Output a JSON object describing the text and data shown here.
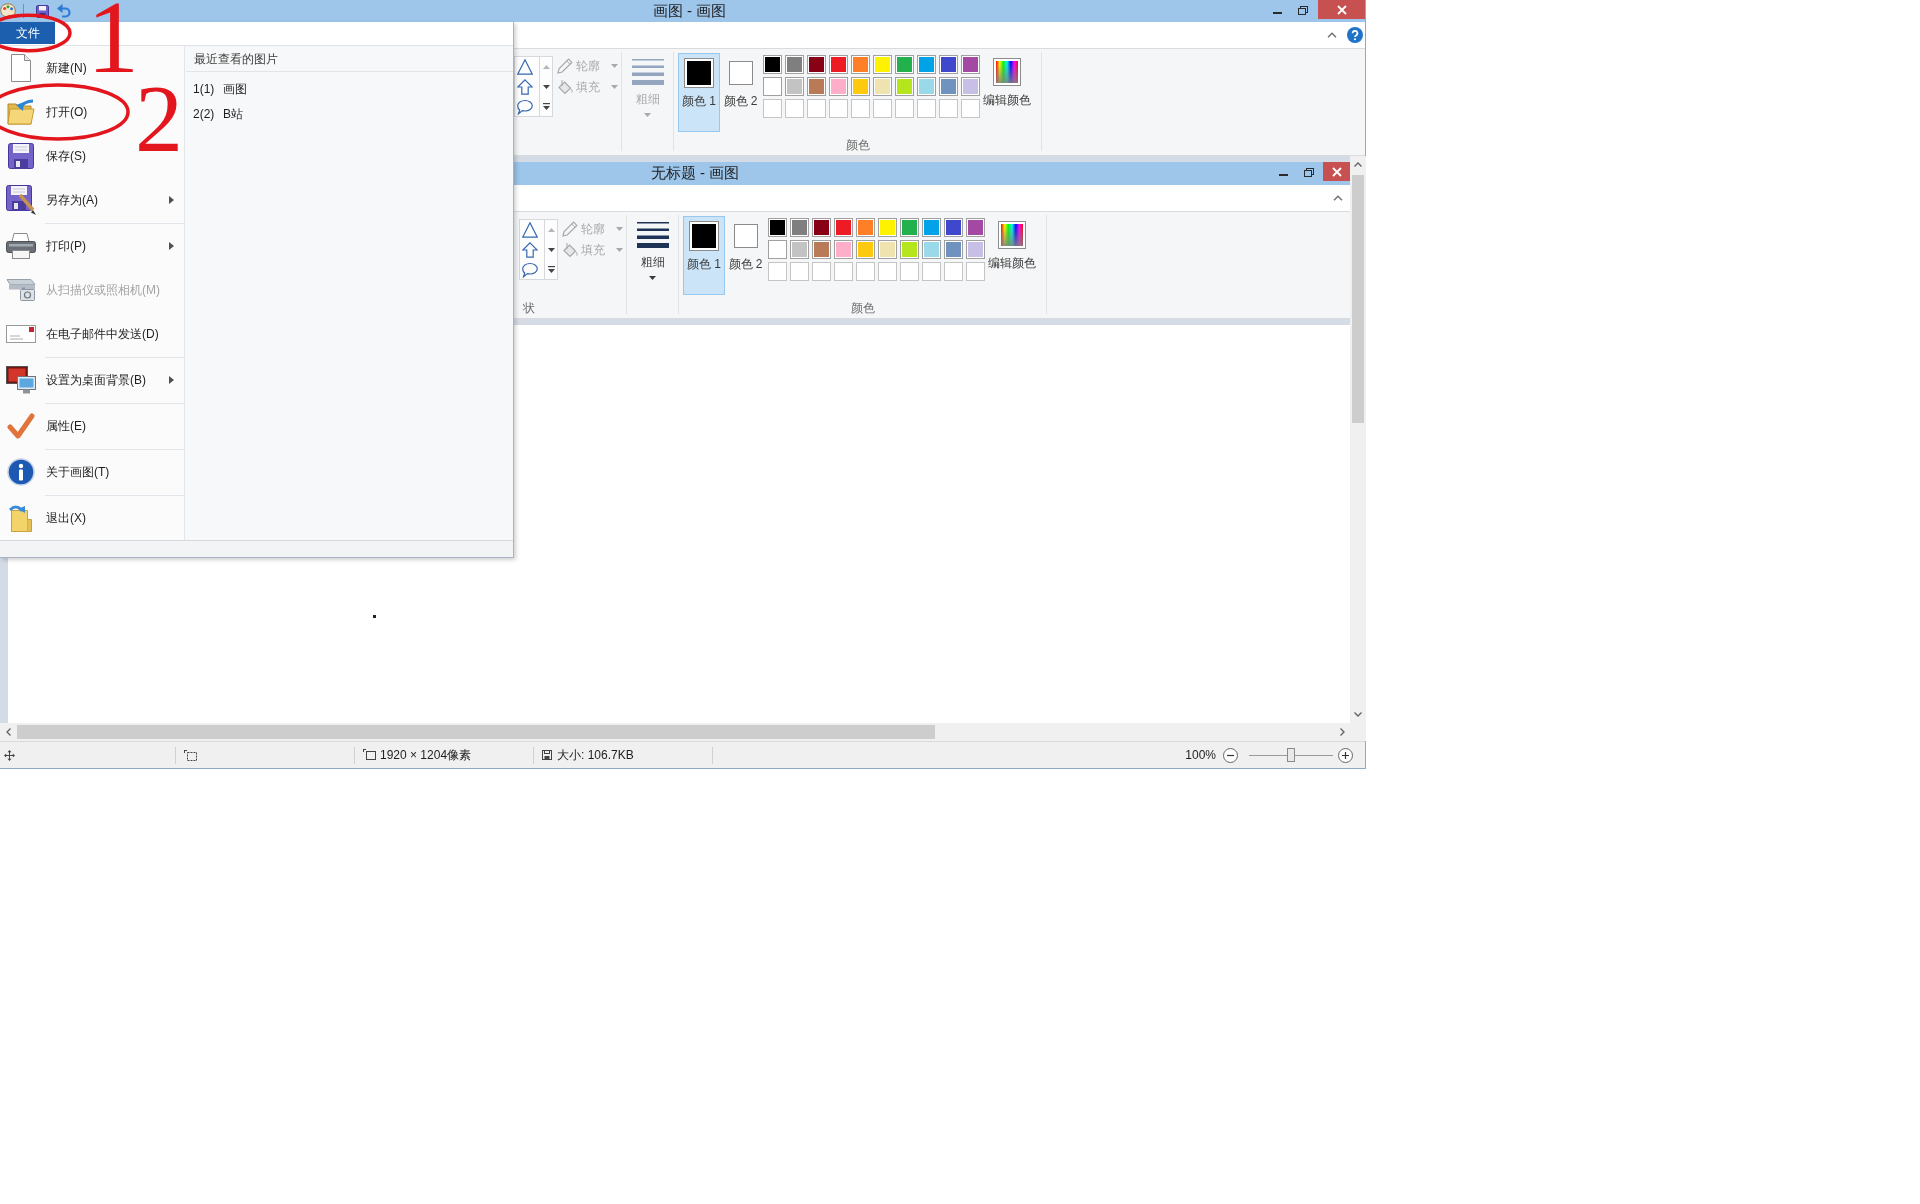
{
  "window": {
    "title": "画图 - 画图",
    "ribbon": {
      "outline": {
        "label": "轮廓",
        "disabled": true
      },
      "fill": {
        "label": "填充",
        "disabled": true
      },
      "size": {
        "label": "粗细",
        "disabled": true
      },
      "color1": {
        "label": "颜色 1",
        "color": "#000000",
        "selected": true
      },
      "color2": {
        "label": "颜色 2",
        "color": "#ffffff",
        "selected": false
      },
      "palette": [
        {
          "kind": "swatch",
          "color": "#000000"
        },
        {
          "kind": "swatch",
          "color": "#7f7f7f"
        },
        {
          "kind": "swatch",
          "color": "#880015"
        },
        {
          "kind": "swatch",
          "color": "#ed1c24"
        },
        {
          "kind": "swatch",
          "color": "#ff7f27"
        },
        {
          "kind": "swatch",
          "color": "#fff200"
        },
        {
          "kind": "swatch",
          "color": "#22b14c"
        },
        {
          "kind": "swatch",
          "color": "#00a2e8"
        },
        {
          "kind": "swatch",
          "color": "#3f48cc"
        },
        {
          "kind": "swatch",
          "color": "#a349a4"
        },
        {
          "kind": "swatch",
          "color": "#ffffff"
        },
        {
          "kind": "swatch",
          "color": "#c3c3c3"
        },
        {
          "kind": "swatch",
          "color": "#b97a57"
        },
        {
          "kind": "swatch",
          "color": "#ffaec9"
        },
        {
          "kind": "swatch",
          "color": "#ffc90e"
        },
        {
          "kind": "swatch",
          "color": "#efe4b0"
        },
        {
          "kind": "swatch",
          "color": "#b5e61d"
        },
        {
          "kind": "swatch",
          "color": "#99d9ea"
        },
        {
          "kind": "swatch",
          "color": "#7092be"
        },
        {
          "kind": "swatch",
          "color": "#c8bfe7"
        },
        {
          "kind": "blank"
        },
        {
          "kind": "blank"
        },
        {
          "kind": "blank"
        },
        {
          "kind": "blank"
        },
        {
          "kind": "blank"
        },
        {
          "kind": "blank"
        },
        {
          "kind": "blank"
        },
        {
          "kind": "blank"
        },
        {
          "kind": "blank"
        },
        {
          "kind": "blank"
        }
      ],
      "edit_colors": {
        "label": "编辑颜色"
      },
      "colors_group": "颜色"
    },
    "status_bar": {
      "canvas_size": "1920 × 1204像素",
      "file_size": "大小: 106.7KB",
      "zoom": "100%",
      "zoom_slider": {
        "level": 0.5
      }
    }
  },
  "file_menu": {
    "tab": {
      "label": "文件",
      "selected": true
    },
    "command_groups": [
      {
        "commands": [
          {
            "label": "新建(N)",
            "submenu": false,
            "disabled": false
          },
          {
            "label": "打开(O)",
            "submenu": false,
            "disabled": false
          },
          {
            "label": "保存(S)",
            "submenu": false,
            "disabled": false
          },
          {
            "label": "另存为(A)",
            "submenu": true,
            "disabled": false
          }
        ]
      },
      {
        "commands": [
          {
            "label": "打印(P)",
            "submenu": true,
            "disabled": false
          },
          {
            "label": "从扫描仪或照相机(M)",
            "submenu": false,
            "disabled": true
          },
          {
            "label": "在电子邮件中发送(D)",
            "submenu": false,
            "disabled": false
          }
        ]
      },
      {
        "commands": [
          {
            "label": "设置为桌面背景(B)",
            "submenu": true,
            "disabled": false
          }
        ]
      },
      {
        "commands": [
          {
            "label": "属性(E)",
            "submenu": false,
            "disabled": false
          }
        ]
      },
      {
        "commands": [
          {
            "label": "关于画图(T)",
            "submenu": false,
            "disabled": false
          }
        ]
      },
      {
        "commands": [
          {
            "label": "退出(X)",
            "submenu": false,
            "disabled": false
          }
        ]
      }
    ],
    "recent_heading": "最近查看的图片",
    "recent_files": [
      {
        "number": "1(1)",
        "name": "画图"
      },
      {
        "number": "2(2)",
        "name": "B站"
      }
    ]
  },
  "image": {
    "title": "无标题 - 画图",
    "ribbon": {
      "shapes_group": "状",
      "outline": {
        "label": "轮廓",
        "disabled": true
      },
      "fill": {
        "label": "填充",
        "disabled": true
      },
      "size": {
        "label": "粗细",
        "disabled": false
      },
      "color1": {
        "label": "颜色 1",
        "color": "#000000",
        "selected": true
      },
      "color2": {
        "label": "颜色 2",
        "color": "#ffffff",
        "selected": false
      },
      "palette": [
        {
          "kind": "swatch",
          "color": "#000000"
        },
        {
          "kind": "swatch",
          "color": "#7f7f7f"
        },
        {
          "kind": "swatch",
          "color": "#880015"
        },
        {
          "kind": "swatch",
          "color": "#ed1c24"
        },
        {
          "kind": "swatch",
          "color": "#ff7f27"
        },
        {
          "kind": "swatch",
          "color": "#fff200"
        },
        {
          "kind": "swatch",
          "color": "#22b14c"
        },
        {
          "kind": "swatch",
          "color": "#00a2e8"
        },
        {
          "kind": "swatch",
          "color": "#3f48cc"
        },
        {
          "kind": "swatch",
          "color": "#a349a4"
        },
        {
          "kind": "swatch",
          "color": "#ffffff"
        },
        {
          "kind": "swatch",
          "color": "#c3c3c3"
        },
        {
          "kind": "swatch",
          "color": "#b97a57"
        },
        {
          "kind": "swatch",
          "color": "#ffaec9"
        },
        {
          "kind": "swatch",
          "color": "#ffc90e"
        },
        {
          "kind": "swatch",
          "color": "#efe4b0"
        },
        {
          "kind": "swatch",
          "color": "#b5e61d"
        },
        {
          "kind": "swatch",
          "color": "#99d9ea"
        },
        {
          "kind": "swatch",
          "color": "#7092be"
        },
        {
          "kind": "swatch",
          "color": "#c8bfe7"
        },
        {
          "kind": "blank"
        },
        {
          "kind": "blank"
        },
        {
          "kind": "blank"
        },
        {
          "kind": "blank"
        },
        {
          "kind": "blank"
        },
        {
          "kind": "blank"
        },
        {
          "kind": "blank"
        },
        {
          "kind": "blank"
        },
        {
          "kind": "blank"
        },
        {
          "kind": "blank"
        }
      ],
      "edit_colors": {
        "label": "编辑颜色"
      },
      "colors_group": "颜色"
    }
  },
  "annotations": [
    {
      "number": "1"
    },
    {
      "number": "2"
    }
  ]
}
